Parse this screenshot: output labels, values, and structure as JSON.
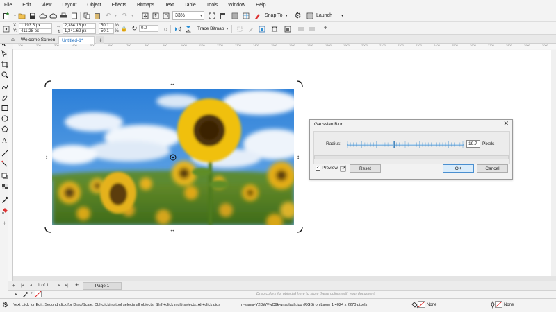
{
  "menu": [
    "File",
    "Edit",
    "View",
    "Layout",
    "Object",
    "Effects",
    "Bitmaps",
    "Text",
    "Table",
    "Tools",
    "Window",
    "Help"
  ],
  "standard_toolbar": {
    "zoom_value": "33%",
    "snap_label": "Snap To",
    "launch_label": "Launch"
  },
  "property_bar": {
    "x_label": "X:",
    "x_value": "1,193.5 px",
    "y_label": "Y:",
    "y_value": "411.28 px",
    "w_value": "2,384.18 px",
    "h_value": "1,341.62 px",
    "sx_value": "50.1",
    "sy_value": "50.1",
    "pct": "%",
    "rotation_value": "0.0",
    "trace_label": "Trace Bitmap"
  },
  "tabs": {
    "welcome": "Welcome Screen",
    "document": "Untitled-1*",
    "add": "+"
  },
  "ruler_ticks": [
    "100",
    "200",
    "300",
    "400",
    "500",
    "600",
    "700",
    "800",
    "900",
    "1000",
    "1100",
    "1200",
    "1300",
    "1400",
    "1500",
    "1600",
    "1700",
    "1800",
    "1900",
    "2000",
    "2100",
    "2200",
    "2300",
    "2400",
    "2500",
    "2600",
    "2700",
    "2800",
    "2900",
    "3000"
  ],
  "dialog": {
    "title": "Gaussian Blur",
    "radius_label": "Radius:",
    "radius_value": "19.7",
    "units": "Pixels",
    "radius_fraction": 0.4,
    "preview_label": "Preview",
    "preview_checked": true,
    "reset_label": "Reset",
    "ok_label": "OK",
    "cancel_label": "Cancel"
  },
  "page_nav": {
    "page_of": "1  of  1",
    "page_tab": "Page 1"
  },
  "palette_hint": "Drag colors (or objects) here to store these colors with your document",
  "status": {
    "hint": "Next click for Edit; Second click for Drag/Scale; Dbl-clicking tool selects all objects; Shift+click multi-selects; Alt+click digs",
    "object_info": "n-sama-Y2DWVwC9k-unsplash.jpg (RGB) on Layer 1 4024 x 2270 pixels",
    "fill_label": "None",
    "outline_label": "None"
  },
  "colors": {
    "accent": "#2a8fd6",
    "selected_button": "#d9ecfb"
  }
}
